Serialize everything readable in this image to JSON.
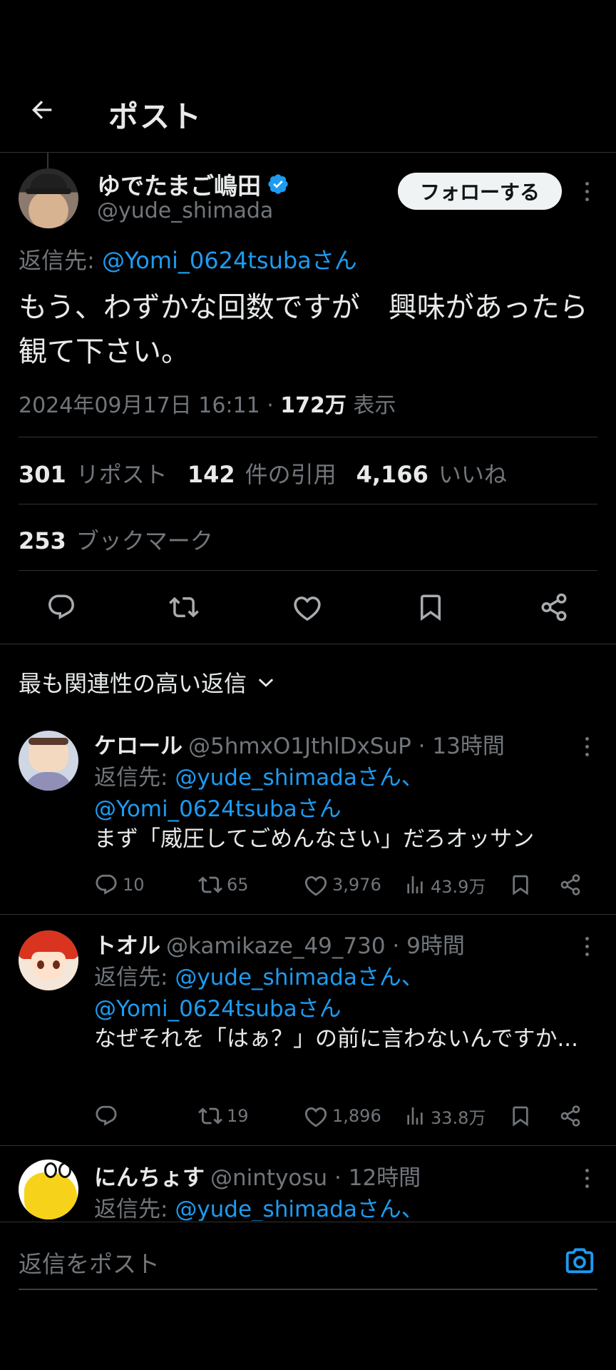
{
  "header": {
    "title": "ポスト"
  },
  "tweet": {
    "author_name": "ゆでたまご嶋田",
    "author_handle": "@yude_shimada",
    "follow_label": "フォローする",
    "reply_to_prefix": "返信先: ",
    "reply_to_handle": "@Yomi_0624tsubaさん",
    "text": "もう、わずかな回数ですが　興味があったら観て下さい。",
    "timestamp": "2024年09月17日 16:11 · ",
    "views_count": "172万",
    "views_label": " 表示",
    "reposts_count": "301",
    "reposts_label": "リポスト",
    "quotes_count": "142",
    "quotes_label": "件の引用",
    "likes_count": "4,166",
    "likes_label": "いいね",
    "bookmarks_count": "253",
    "bookmarks_label": "ブックマーク"
  },
  "sort": {
    "label": "最も関連性の高い返信"
  },
  "replies": [
    {
      "name": "ケロール",
      "handle_time": "@5hmxO1JthlDxSuP · 13時間",
      "reply_prefix": "返信先: ",
      "reply_handle_1": "@yude_shimadaさん、",
      "reply_handle_2": "@Yomi_0624tsubaさん",
      "text": "まず「威圧してごめんなさい」だろオッサン",
      "replies": "10",
      "reposts": "65",
      "likes": "3,976",
      "views": "43.9万"
    },
    {
      "name": "トオル",
      "handle_time": "@kamikaze_49_730 · 9時間",
      "reply_prefix": "返信先: ",
      "reply_handle_1": "@yude_shimadaさん、",
      "reply_handle_2": "@Yomi_0624tsubaさん",
      "text": "なぜそれを「はぁ？」の前に言わないんですか...",
      "replies": "",
      "reposts": "19",
      "likes": "1,896",
      "views": "33.8万"
    },
    {
      "name": "にんちょす",
      "handle_time": "@nintyosu · 12時間",
      "reply_prefix": "返信先: ",
      "reply_handle_1": "@yude_shimadaさん、"
    }
  ],
  "composer": {
    "placeholder": "返信をポスト"
  },
  "colors": {
    "accent": "#1d9bf0",
    "background": "#000000",
    "muted": "#71767b"
  },
  "icons": [
    "back-arrow-icon",
    "verified-badge-icon",
    "reply-icon",
    "repost-icon",
    "like-icon",
    "bookmark-icon",
    "share-icon",
    "chevron-down-icon",
    "views-icon",
    "camera-icon",
    "more-icon"
  ]
}
